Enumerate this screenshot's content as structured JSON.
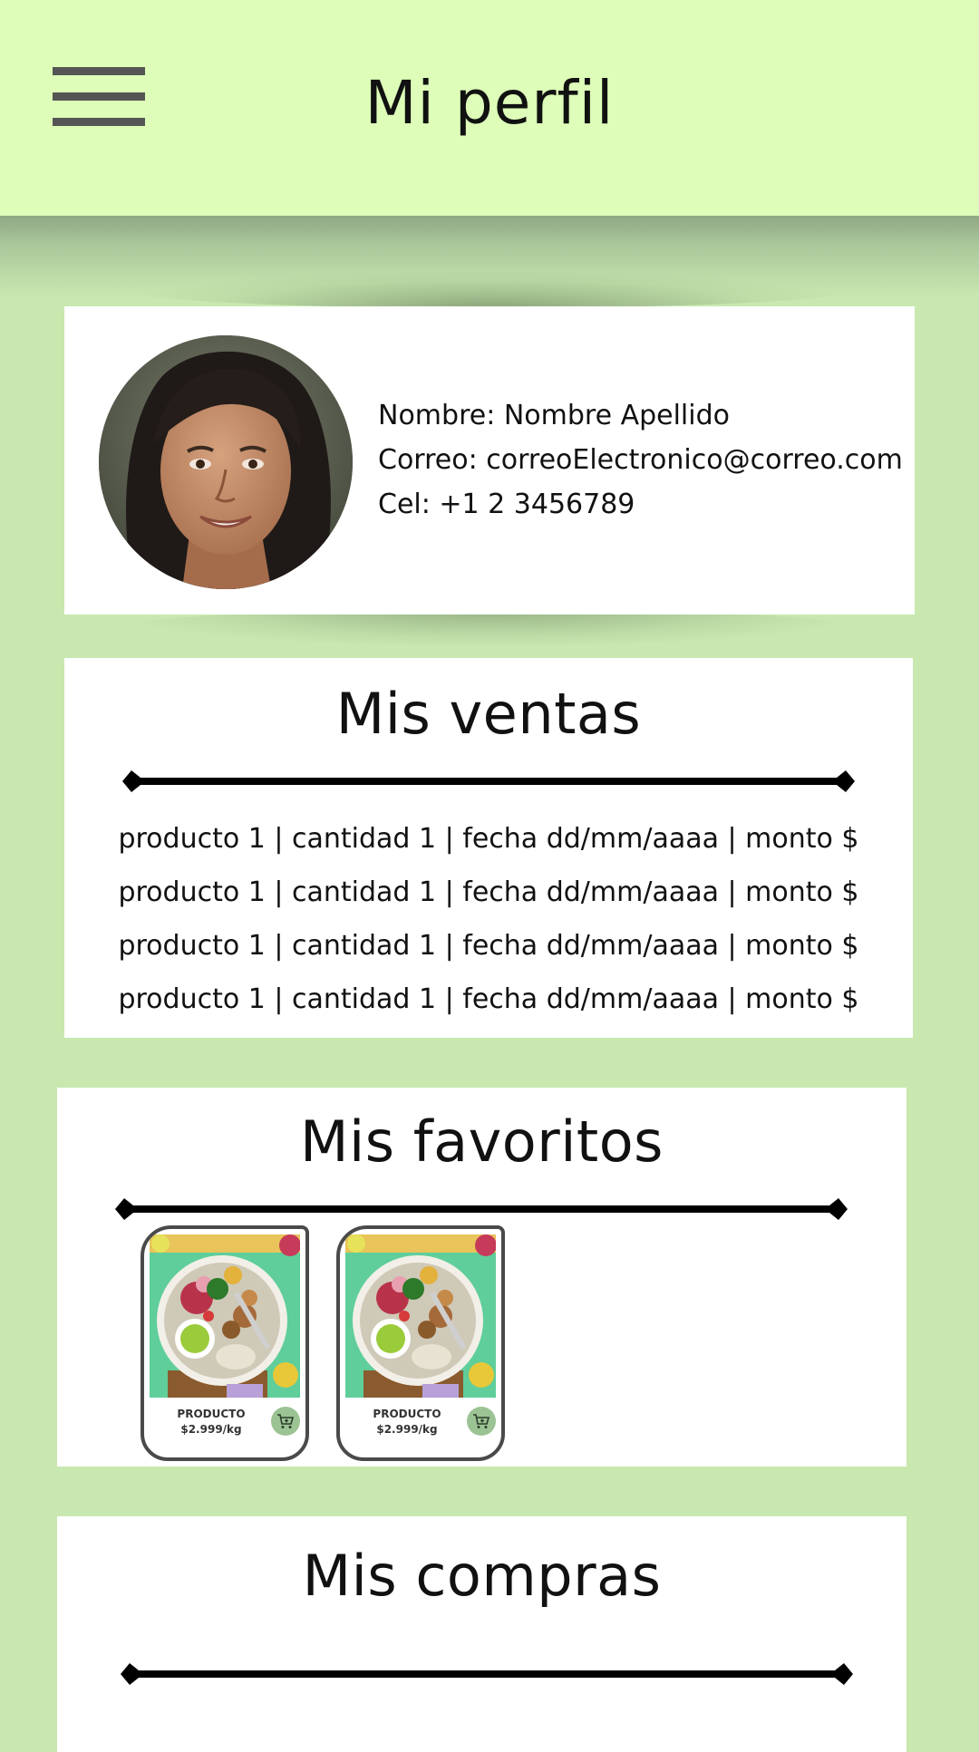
{
  "header": {
    "title": "Mi perfil",
    "menu_icon": "hamburger-menu-icon"
  },
  "profile": {
    "avatar_icon": "user-avatar",
    "name_line": "Nombre: Nombre Apellido",
    "email_line": "Correo: correoElectronico@correo.com",
    "phone_line": "Cel: +1 2 3456789"
  },
  "sales": {
    "title": "Mis ventas",
    "rows": [
      "producto 1 | cantidad 1 | fecha dd/mm/aaaa | monto $",
      "producto 1 | cantidad 1 | fecha dd/mm/aaaa | monto $",
      "producto 1 | cantidad 1 | fecha dd/mm/aaaa | monto $",
      "producto 1 | cantidad 1 | fecha dd/mm/aaaa | monto $"
    ]
  },
  "favorites": {
    "title": "Mis favoritos",
    "items": [
      {
        "name": "PRODUCTO",
        "price": "$2.999/kg",
        "icon": "add-to-cart-icon"
      },
      {
        "name": "PRODUCTO",
        "price": "$2.999/kg",
        "icon": "add-to-cart-icon"
      }
    ]
  },
  "purchases": {
    "title": "Mis compras"
  },
  "colors": {
    "background": "#c8e8b0",
    "header": "#ddfdb8",
    "card": "#ffffff",
    "cart_button": "#9cc393"
  }
}
